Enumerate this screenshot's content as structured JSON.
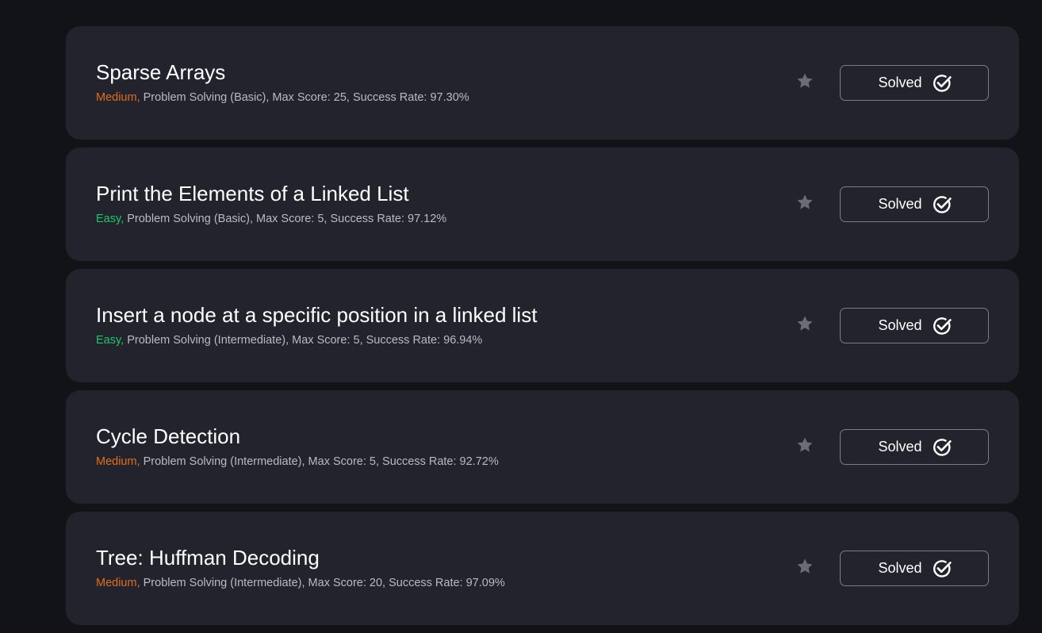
{
  "colors": {
    "background": "#121317",
    "card": "#22232d",
    "medium": "#e06f1b",
    "easy": "#1ec767",
    "meta_text": "#b9bac6",
    "star": "#6b6c76"
  },
  "icons": {
    "star": "star-icon",
    "solved": "check-circle-icon"
  },
  "challenges": [
    {
      "title": "Sparse Arrays",
      "difficulty": "Medium,",
      "difficulty_level": "medium",
      "details": " Problem Solving (Basic), Max Score: 25, Success Rate: 97.30%",
      "status": "Solved"
    },
    {
      "title": "Print the Elements of a Linked List",
      "difficulty": "Easy,",
      "difficulty_level": "easy",
      "details": " Problem Solving (Basic), Max Score: 5, Success Rate: 97.12%",
      "status": "Solved"
    },
    {
      "title": "Insert a node at a specific position in a linked list",
      "difficulty": "Easy,",
      "difficulty_level": "easy",
      "details": " Problem Solving (Intermediate), Max Score: 5, Success Rate: 96.94%",
      "status": "Solved"
    },
    {
      "title": "Cycle Detection",
      "difficulty": "Medium,",
      "difficulty_level": "medium",
      "details": " Problem Solving (Intermediate), Max Score: 5, Success Rate: 92.72%",
      "status": "Solved"
    },
    {
      "title": "Tree: Huffman Decoding",
      "difficulty": "Medium,",
      "difficulty_level": "medium",
      "details": " Problem Solving (Intermediate), Max Score: 20, Success Rate: 97.09%",
      "status": "Solved"
    }
  ]
}
